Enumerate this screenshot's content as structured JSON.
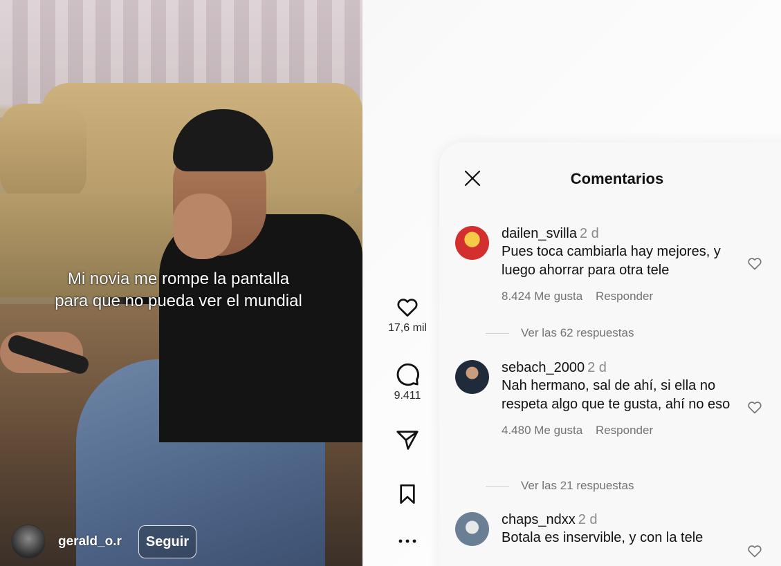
{
  "video": {
    "caption_line1": "Mi novia me rompe la pantalla",
    "caption_line2": "para que no pueda ver el mundial",
    "author": "gerald_o.r",
    "follow_label": "Seguir"
  },
  "actions": {
    "likes": "17,6 mil",
    "comments": "9.411",
    "icons": [
      "heart-icon",
      "comment-icon",
      "share-icon",
      "bookmark-icon",
      "more-icon"
    ]
  },
  "comments_panel": {
    "title": "Comentarios",
    "comments": [
      {
        "user": "dailen_svilla",
        "time": "2 d",
        "text": "Pues toca cambiarla hay mejores, y luego ahorrar para otra tele",
        "likes": "8.424 Me gusta",
        "reply": "Responder",
        "view_replies": "Ver las 62 respuestas",
        "avatar_color": "#c62828"
      },
      {
        "user": "sebach_2000",
        "time": "2 d",
        "text": "Nah hermano, sal de ahí, si ella no respeta algo que te gusta, ahí no eso",
        "likes": "4.480 Me gusta",
        "reply": "Responder",
        "view_replies": "Ver las 21 respuestas",
        "avatar_color": "#1f2a3a"
      },
      {
        "user": "chaps_ndxx",
        "time": "2 d",
        "text": "Botala es inservible, y con la tele",
        "avatar_color": "#6a7f94"
      }
    ]
  },
  "colors": {
    "panel_bg": "#f8f8f8",
    "text": "#111111",
    "muted": "#737373"
  }
}
